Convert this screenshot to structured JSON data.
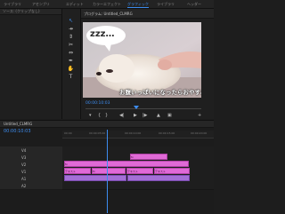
{
  "workspace_tabs": [
    "ライブラリ",
    "アセンブリ",
    "エディット",
    "カラー",
    "エフェクト",
    "オーディオ",
    "グラフィック",
    "ライブラリ",
    "ヘッダー"
  ],
  "active_tab_index": 6,
  "left_panel": {
    "title": "ソース: (クリップなし)"
  },
  "program_monitor": {
    "title": "プログラム: Untitled_CLMRG",
    "timecode": "00:00:10:03",
    "subtitle_top": "zzz…",
    "subtitle_bottom": "お腹いっぱいになったらおやすみ"
  },
  "timeline": {
    "title": "Untitled_CLMRG",
    "timecode": "00:00:10:03",
    "ruler_ticks": [
      "00:00",
      "00:00:05:00",
      "00:00:10:00",
      "00:00:15:00",
      "00:00:20:00"
    ],
    "tracks": [
      {
        "label": "V4",
        "clips": []
      },
      {
        "label": "V3",
        "clips": [
          {
            "label": "fx",
            "style": "pink"
          }
        ]
      },
      {
        "label": "V2",
        "clips": [
          {
            "label": "fx",
            "style": "pink"
          }
        ]
      },
      {
        "label": "V1",
        "clips": [
          {
            "label": "テキスト",
            "style": "pink"
          },
          {
            "label": "fx",
            "style": "pink"
          },
          {
            "label": "テキスト",
            "style": "pink"
          },
          {
            "label": "テキスト",
            "style": "pink"
          }
        ]
      },
      {
        "label": "A1",
        "clips": [
          {
            "label": "",
            "style": "purple"
          },
          {
            "label": "",
            "style": "purple"
          }
        ]
      },
      {
        "label": "A2",
        "clips": []
      }
    ]
  },
  "colors": {
    "accent": "#3d8df0",
    "clip": "#e06ad6",
    "audio_clip": "#a46fd6"
  }
}
